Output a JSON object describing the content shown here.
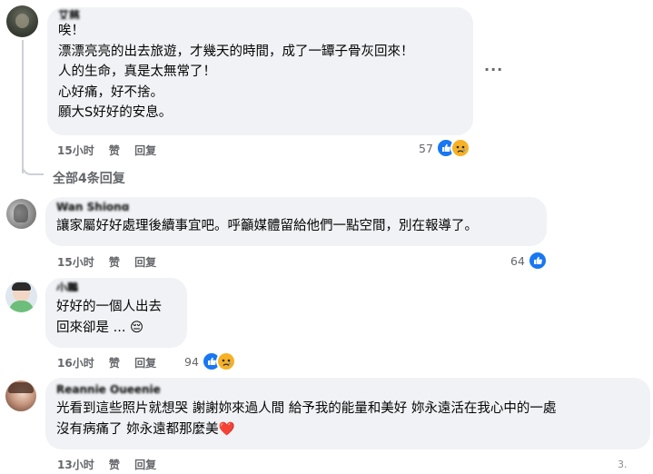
{
  "comments": [
    {
      "author": "艾慈",
      "text": "唉！\n漂漂亮亮的出去旅遊，才幾天的時間，成了一罈子骨灰回來！\n人的生命，真是太無常了！\n心好痛，好不捨。\n願大S好好的安息。",
      "time": "15小时",
      "like_label": "赞",
      "reply_label": "回复",
      "reaction_count": "57"
    },
    {
      "author": "Wan Shiong",
      "text": "讓家屬好好處理後續事宜吧。呼籲媒體留給他們一點空間，別在報導了。",
      "time": "15小时",
      "like_label": "赞",
      "reply_label": "回复",
      "reaction_count": "64"
    },
    {
      "author": "小鵬",
      "text": "好好的一個人出去\n回來卻是 ... 😔",
      "time": "16小时",
      "like_label": "赞",
      "reply_label": "回复",
      "reaction_count": "94"
    },
    {
      "author": "Reannie Queenie",
      "text": "光看到這些照片就想哭 謝謝妳來過人間 給予我的能量和美好 妳永遠活在我心中的一處\n沒有病痛了 妳永遠都那麼美❤️",
      "time": "13小时",
      "like_label": "赞",
      "reply_label": "回复",
      "reaction_count": ""
    }
  ],
  "view_replies": "全部4条回复",
  "more_options": "···",
  "watermark": "3."
}
